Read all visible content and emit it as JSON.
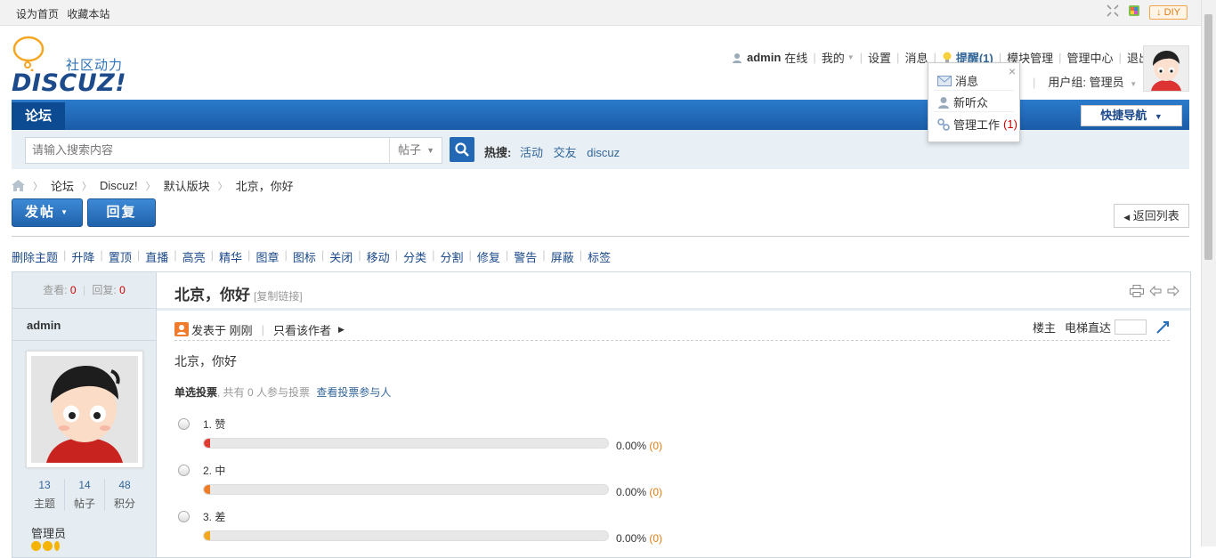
{
  "toolbar": {
    "set_home": "设为首页",
    "bookmark": "收藏本站",
    "diy": "DIY"
  },
  "logo": {
    "tagline": "社区动力",
    "wordmark": "DISCUZ!"
  },
  "usermenu": {
    "username": "admin",
    "online": "在线",
    "mine": "我的",
    "settings": "设置",
    "messages": "消息",
    "remind": "提醒(1)",
    "module_admin": "模块管理",
    "admin_center": "管理中心",
    "logout": "退出",
    "usergroup": "用户组: 管理员"
  },
  "remind_popup": {
    "items": [
      {
        "label": "消息",
        "count": ""
      },
      {
        "label": "新听众",
        "count": ""
      },
      {
        "label": "管理工作",
        "count": "(1)"
      }
    ]
  },
  "nav": {
    "tab": "论坛",
    "quick_nav": "快捷导航"
  },
  "search": {
    "placeholder": "请输入搜索内容",
    "type": "帖子",
    "hot_label": "热搜:",
    "hot": [
      "活动",
      "交友",
      "discuz"
    ]
  },
  "breadcrumb": [
    "论坛",
    "Discuz!",
    "默认版块",
    "北京，你好"
  ],
  "actions": {
    "post": "发帖",
    "reply": "回复",
    "back": "返回列表"
  },
  "mod_actions": [
    "删除主题",
    "升降",
    "置顶",
    "直播",
    "高亮",
    "精华",
    "图章",
    "图标",
    "关闭",
    "移动",
    "分类",
    "分割",
    "修复",
    "警告",
    "屏蔽",
    "标签"
  ],
  "thread": {
    "views_label": "查看:",
    "views": "0",
    "replies_label": "回复:",
    "replies": "0",
    "title": "北京，你好",
    "copy_link": "[复制链接]",
    "author": "admin",
    "author_stats": [
      {
        "value": "13",
        "label": "主题"
      },
      {
        "value": "14",
        "label": "帖子"
      },
      {
        "value": "48",
        "label": "积分"
      }
    ],
    "author_group": "管理员",
    "posted": "发表于 刚刚",
    "only_author": "只看该作者",
    "floor": "楼主",
    "elevator": "电梯直达",
    "content": "北京，你好"
  },
  "poll": {
    "type": "单选投票",
    "summary": ", 共有 0 人参与投票",
    "view_voters": "查看投票参与人",
    "options": [
      {
        "label": "1.  赞",
        "percent": "0.00%",
        "count": "(0)",
        "color": "#e03c31"
      },
      {
        "label": "2.  中",
        "percent": "0.00%",
        "count": "(0)",
        "color": "#ee7d25"
      },
      {
        "label": "3.  差",
        "percent": "0.00%",
        "count": "(0)",
        "color": "#f2a81d"
      }
    ]
  }
}
